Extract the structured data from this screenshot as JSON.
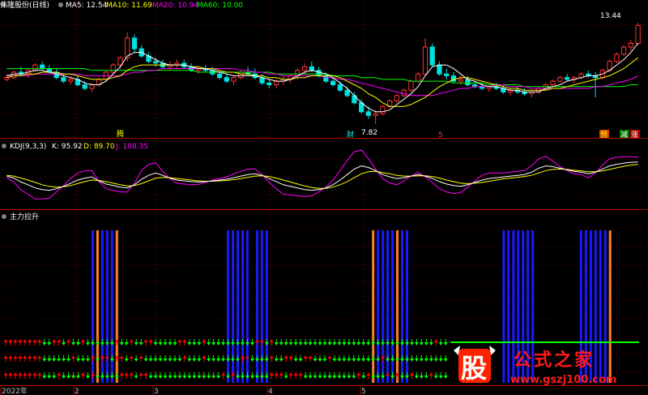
{
  "colors": {
    "up": "#ff3232",
    "down": "#00e0e0",
    "ma5": "#ffffff",
    "ma10": "#ffff00",
    "ma20": "#ff00ff",
    "ma60": "#00ff00",
    "k": "#ffffff",
    "d": "#ffff00",
    "j": "#ff00ff",
    "bar_blue": "#1a1aff",
    "bar_orange": "#ff7f27",
    "arrow_green": "#00ff00",
    "arrow_red": "#ff0000",
    "grid": "#800000"
  },
  "price_panel": {
    "stock_name": "伟隆股份(日线)",
    "ma5_label": "MA5: 12.54",
    "ma10_label": "MA10: 11.69",
    "ma20_label": "MA20: 10.94",
    "ma60_label": "MA60: 10.00",
    "high_label": "13.44",
    "low_label": "7.82",
    "markers": [
      "腾",
      "财",
      "5",
      "预",
      "减",
      "涨"
    ]
  },
  "kdj_panel": {
    "title": "KDJ(9,3,3)",
    "k_label": "K: 95.92",
    "d_label": "D: 89.70",
    "j_label": "J: 108.35"
  },
  "signal_panel": {
    "title": "主力拉升"
  },
  "x_axis": {
    "ticks": [
      "2022年",
      "2",
      "3",
      "4",
      "5"
    ]
  },
  "watermark": {
    "logo_text": "股",
    "title": "公式之家",
    "url": "www.gszj100.com"
  },
  "chart_data": {
    "type": "candlestick",
    "ylim": [
      7.5,
      13.9
    ],
    "ohlc": [
      [
        10.3,
        10.6,
        10.2,
        10.4
      ],
      [
        10.4,
        10.8,
        10.3,
        10.7
      ],
      [
        10.7,
        11.0,
        10.5,
        10.6
      ],
      [
        10.6,
        10.9,
        10.4,
        10.8
      ],
      [
        10.8,
        11.2,
        10.7,
        11.1
      ],
      [
        11.1,
        11.3,
        10.8,
        10.9
      ],
      [
        10.9,
        11.1,
        10.6,
        10.7
      ],
      [
        10.7,
        10.9,
        10.3,
        10.4
      ],
      [
        10.4,
        10.6,
        10.1,
        10.2
      ],
      [
        10.2,
        10.5,
        10.0,
        10.3
      ],
      [
        10.3,
        10.5,
        9.9,
        10.0
      ],
      [
        10.0,
        10.2,
        9.7,
        9.8
      ],
      [
        9.8,
        10.1,
        9.6,
        10.0
      ],
      [
        10.0,
        10.4,
        9.9,
        10.3
      ],
      [
        10.3,
        10.8,
        10.2,
        10.7
      ],
      [
        10.7,
        11.2,
        10.6,
        11.1
      ],
      [
        11.1,
        11.6,
        10.9,
        11.5
      ],
      [
        11.5,
        12.9,
        11.3,
        12.6
      ],
      [
        12.6,
        12.8,
        11.8,
        12.0
      ],
      [
        12.0,
        12.2,
        11.5,
        11.6
      ],
      [
        11.6,
        11.8,
        11.2,
        11.3
      ],
      [
        11.3,
        11.5,
        11.0,
        11.2
      ],
      [
        11.2,
        11.4,
        10.9,
        11.0
      ],
      [
        11.0,
        11.3,
        10.8,
        11.1
      ],
      [
        11.1,
        11.4,
        10.9,
        11.2
      ],
      [
        11.2,
        11.4,
        10.9,
        11.0
      ],
      [
        11.0,
        11.2,
        10.7,
        10.8
      ],
      [
        10.8,
        11.0,
        10.6,
        10.9
      ],
      [
        10.9,
        11.1,
        10.7,
        10.8
      ],
      [
        10.8,
        11.0,
        10.5,
        10.6
      ],
      [
        10.6,
        10.8,
        10.3,
        10.4
      ],
      [
        10.4,
        10.6,
        10.1,
        10.2
      ],
      [
        10.2,
        10.5,
        10.0,
        10.4
      ],
      [
        10.4,
        10.8,
        10.3,
        10.7
      ],
      [
        10.7,
        11.0,
        10.5,
        10.6
      ],
      [
        10.6,
        10.9,
        10.3,
        10.4
      ],
      [
        10.4,
        10.6,
        10.0,
        10.1
      ],
      [
        10.1,
        10.3,
        9.8,
        10.0
      ],
      [
        10.0,
        10.3,
        9.8,
        10.2
      ],
      [
        10.2,
        10.5,
        10.0,
        10.3
      ],
      [
        10.3,
        10.6,
        10.1,
        10.5
      ],
      [
        10.5,
        10.9,
        10.3,
        10.8
      ],
      [
        10.8,
        11.2,
        10.6,
        11.0
      ],
      [
        11.0,
        11.3,
        10.7,
        10.8
      ],
      [
        10.8,
        11.0,
        10.4,
        10.5
      ],
      [
        10.5,
        10.7,
        10.1,
        10.2
      ],
      [
        10.2,
        10.4,
        9.9,
        10.0
      ],
      [
        10.0,
        10.2,
        9.6,
        9.7
      ],
      [
        9.7,
        9.9,
        9.3,
        9.4
      ],
      [
        9.4,
        9.6,
        8.9,
        9.0
      ],
      [
        9.0,
        9.2,
        8.4,
        8.5
      ],
      [
        8.5,
        8.8,
        8.1,
        8.3
      ],
      [
        8.3,
        8.6,
        7.82,
        8.4
      ],
      [
        8.4,
        8.9,
        8.3,
        8.8
      ],
      [
        8.8,
        9.2,
        8.7,
        9.1
      ],
      [
        9.1,
        9.5,
        9.0,
        9.4
      ],
      [
        9.4,
        9.8,
        9.3,
        9.7
      ],
      [
        9.7,
        10.3,
        9.6,
        10.2
      ],
      [
        10.2,
        10.7,
        10.1,
        10.6
      ],
      [
        10.6,
        12.6,
        10.5,
        12.1
      ],
      [
        12.1,
        12.3,
        11.0,
        11.1
      ],
      [
        11.1,
        11.3,
        10.5,
        10.6
      ],
      [
        10.6,
        10.9,
        10.3,
        10.5
      ],
      [
        10.5,
        10.7,
        10.1,
        10.2
      ],
      [
        10.2,
        10.5,
        10.0,
        10.3
      ],
      [
        10.3,
        10.5,
        9.9,
        10.0
      ],
      [
        10.0,
        10.2,
        9.8,
        9.9
      ],
      [
        9.9,
        10.1,
        9.7,
        9.8
      ],
      [
        9.8,
        10.0,
        9.6,
        9.9
      ],
      [
        9.9,
        10.1,
        9.7,
        9.8
      ],
      [
        9.8,
        10.0,
        9.5,
        9.6
      ],
      [
        9.6,
        9.8,
        9.4,
        9.7
      ],
      [
        9.7,
        9.9,
        9.5,
        9.6
      ],
      [
        9.6,
        9.8,
        9.4,
        9.5
      ],
      [
        9.5,
        9.7,
        9.3,
        9.6
      ],
      [
        9.6,
        9.9,
        9.5,
        9.8
      ],
      [
        9.8,
        10.1,
        9.7,
        10.0
      ],
      [
        10.0,
        10.3,
        9.9,
        10.2
      ],
      [
        10.2,
        10.5,
        10.1,
        10.4
      ],
      [
        10.4,
        10.6,
        10.2,
        10.3
      ],
      [
        10.3,
        10.5,
        10.1,
        10.4
      ],
      [
        10.4,
        10.7,
        10.3,
        10.6
      ],
      [
        10.6,
        10.8,
        10.4,
        10.5
      ],
      [
        10.5,
        10.7,
        9.3,
        10.4
      ],
      [
        10.4,
        10.9,
        10.3,
        10.8
      ],
      [
        10.8,
        11.4,
        10.7,
        11.3
      ],
      [
        11.3,
        11.8,
        11.2,
        11.7
      ],
      [
        11.7,
        12.2,
        11.6,
        12.1
      ],
      [
        12.1,
        12.5,
        11.9,
        12.3
      ],
      [
        12.3,
        13.44,
        12.2,
        13.3
      ]
    ],
    "ma5": [
      10.5,
      10.6,
      10.6,
      10.7,
      10.8,
      10.8,
      10.7,
      10.6,
      10.5,
      10.4,
      10.3,
      10.1,
      10.0,
      10.0,
      10.2,
      10.6,
      11.0,
      11.6,
      11.8,
      11.8,
      11.6,
      11.4,
      11.2,
      11.1,
      11.1,
      11.1,
      11.0,
      10.9,
      10.9,
      10.8,
      10.7,
      10.6,
      10.5,
      10.5,
      10.5,
      10.5,
      10.4,
      10.3,
      10.2,
      10.2,
      10.3,
      10.5,
      10.7,
      10.8,
      10.7,
      10.6,
      10.4,
      10.1,
      9.8,
      9.4,
      9.0,
      8.7,
      8.5,
      8.5,
      8.6,
      8.9,
      9.2,
      9.5,
      9.9,
      10.5,
      11.0,
      11.1,
      11.1,
      10.9,
      10.6,
      10.3,
      10.2,
      10.0,
      9.9,
      9.9,
      9.8,
      9.7,
      9.7,
      9.6,
      9.6,
      9.6,
      9.8,
      9.9,
      10.0,
      10.2,
      10.3,
      10.4,
      10.5,
      10.5,
      10.6,
      10.8,
      11.1,
      11.4,
      11.8,
      12.3
    ],
    "ma10": [
      10.4,
      10.5,
      10.5,
      10.6,
      10.6,
      10.7,
      10.7,
      10.7,
      10.6,
      10.6,
      10.5,
      10.4,
      10.3,
      10.3,
      10.3,
      10.4,
      10.5,
      10.8,
      11.0,
      11.1,
      11.1,
      11.1,
      11.1,
      11.1,
      11.1,
      11.1,
      11.0,
      11.0,
      10.9,
      10.9,
      10.8,
      10.7,
      10.7,
      10.6,
      10.6,
      10.5,
      10.5,
      10.4,
      10.4,
      10.3,
      10.3,
      10.4,
      10.4,
      10.5,
      10.5,
      10.5,
      10.5,
      10.4,
      10.2,
      10.0,
      9.8,
      9.5,
      9.3,
      9.0,
      8.8,
      8.8,
      8.8,
      8.9,
      9.1,
      9.3,
      9.6,
      9.9,
      10.1,
      10.3,
      10.4,
      10.4,
      10.3,
      10.2,
      10.1,
      10.0,
      9.9,
      9.8,
      9.8,
      9.7,
      9.7,
      9.7,
      9.7,
      9.8,
      9.8,
      9.9,
      10.0,
      10.1,
      10.2,
      10.3,
      10.4,
      10.5,
      10.7,
      10.9,
      11.2,
      11.5
    ],
    "ma20": [
      10.5,
      10.5,
      10.5,
      10.5,
      10.6,
      10.6,
      10.6,
      10.6,
      10.6,
      10.6,
      10.6,
      10.5,
      10.5,
      10.5,
      10.5,
      10.5,
      10.5,
      10.6,
      10.7,
      10.7,
      10.8,
      10.8,
      10.9,
      10.9,
      10.9,
      10.9,
      10.9,
      10.9,
      10.9,
      10.9,
      10.9,
      10.9,
      10.9,
      10.8,
      10.8,
      10.7,
      10.7,
      10.6,
      10.6,
      10.5,
      10.5,
      10.5,
      10.5,
      10.5,
      10.5,
      10.4,
      10.4,
      10.3,
      10.3,
      10.2,
      10.1,
      10.0,
      9.9,
      9.8,
      9.7,
      9.6,
      9.5,
      9.4,
      9.4,
      9.4,
      9.4,
      9.5,
      9.6,
      9.7,
      9.8,
      9.8,
      9.9,
      9.9,
      9.9,
      10.0,
      10.0,
      9.9,
      9.9,
      9.9,
      9.8,
      9.8,
      9.8,
      9.8,
      9.8,
      9.8,
      9.8,
      9.8,
      9.8,
      9.9,
      9.9,
      10.0,
      10.1,
      10.2,
      10.3,
      10.5
    ],
    "ma60": [
      10.9,
      10.9,
      10.9,
      10.9,
      10.9,
      10.9,
      10.9,
      10.9,
      10.9,
      10.9,
      10.9,
      10.9,
      10.8,
      10.8,
      10.8,
      10.8,
      10.8,
      10.8,
      10.8,
      10.8,
      10.8,
      10.8,
      10.8,
      10.8,
      10.8,
      10.8,
      10.8,
      10.7,
      10.7,
      10.7,
      10.7,
      10.7,
      10.7,
      10.7,
      10.7,
      10.7,
      10.7,
      10.7,
      10.6,
      10.6,
      10.6,
      10.6,
      10.6,
      10.6,
      10.6,
      10.6,
      10.5,
      10.5,
      10.5,
      10.5,
      10.4,
      10.4,
      10.4,
      10.3,
      10.3,
      10.3,
      10.3,
      10.2,
      10.2,
      10.2,
      10.2,
      10.2,
      10.2,
      10.1,
      10.1,
      10.1,
      10.1,
      10.1,
      10.0,
      10.0,
      10.0,
      10.0,
      10.0,
      9.9,
      9.9,
      9.9,
      9.9,
      9.9,
      9.9,
      9.9,
      9.9,
      9.9,
      9.9,
      9.9,
      9.9,
      9.9,
      9.9,
      9.9,
      10.0,
      10.0
    ],
    "kdj": {
      "ylim": [
        -20,
        120
      ],
      "k": [
        60,
        55,
        45,
        38,
        30,
        26,
        24,
        28,
        34,
        42,
        50,
        55,
        58,
        48,
        40,
        36,
        32,
        30,
        38,
        52,
        62,
        68,
        62,
        55,
        50,
        48,
        46,
        45,
        46,
        48,
        50,
        52,
        56,
        60,
        64,
        66,
        62,
        54,
        46,
        38,
        34,
        30,
        26,
        24,
        26,
        30,
        38,
        50,
        64,
        78,
        86,
        82,
        74,
        64,
        58,
        54,
        56,
        60,
        64,
        60,
        54,
        46,
        40,
        36,
        34,
        38,
        44,
        50,
        54,
        56,
        58,
        60,
        62,
        64,
        70,
        80,
        86,
        84,
        80,
        76,
        72,
        70,
        66,
        70,
        78,
        86,
        90,
        93,
        95,
        95.92
      ],
      "d": [
        62,
        60,
        55,
        50,
        44,
        38,
        34,
        32,
        33,
        36,
        41,
        46,
        50,
        49,
        46,
        42,
        38,
        35,
        36,
        41,
        48,
        55,
        57,
        56,
        54,
        52,
        50,
        48,
        47,
        47,
        48,
        49,
        51,
        54,
        57,
        60,
        61,
        59,
        55,
        50,
        45,
        40,
        35,
        31,
        29,
        29,
        32,
        38,
        46,
        56,
        66,
        71,
        72,
        69,
        66,
        62,
        60,
        60,
        61,
        61,
        59,
        55,
        50,
        46,
        42,
        41,
        42,
        44,
        47,
        50,
        53,
        55,
        57,
        59,
        62,
        68,
        74,
        77,
        78,
        77,
        75,
        73,
        71,
        71,
        73,
        77,
        81,
        85,
        88,
        89.7
      ],
      "j": [
        56,
        45,
        25,
        14,
        2,
        2,
        4,
        20,
        36,
        54,
        68,
        73,
        74,
        46,
        28,
        24,
        20,
        20,
        42,
        74,
        90,
        94,
        72,
        53,
        42,
        40,
        38,
        39,
        44,
        50,
        54,
        58,
        66,
        72,
        78,
        78,
        64,
        44,
        28,
        14,
        12,
        10,
        8,
        10,
        20,
        32,
        50,
        74,
        100,
        122,
        126,
        104,
        78,
        54,
        42,
        38,
        48,
        60,
        70,
        58,
        44,
        28,
        20,
        16,
        18,
        32,
        48,
        62,
        68,
        68,
        68,
        70,
        72,
        74,
        86,
        104,
        110,
        98,
        84,
        74,
        66,
        64,
        56,
        68,
        88,
        104,
        108,
        109,
        109,
        108.35
      ]
    },
    "signal_bars": {
      "blue": [
        18,
        20,
        21,
        22,
        46,
        47,
        48,
        49,
        50,
        52,
        53,
        54,
        77,
        78,
        79,
        80,
        82,
        83,
        103,
        104,
        105,
        106,
        107,
        108,
        109,
        119,
        120,
        121,
        122,
        123,
        124
      ],
      "orange": [
        19,
        23,
        76,
        81,
        125
      ]
    }
  }
}
